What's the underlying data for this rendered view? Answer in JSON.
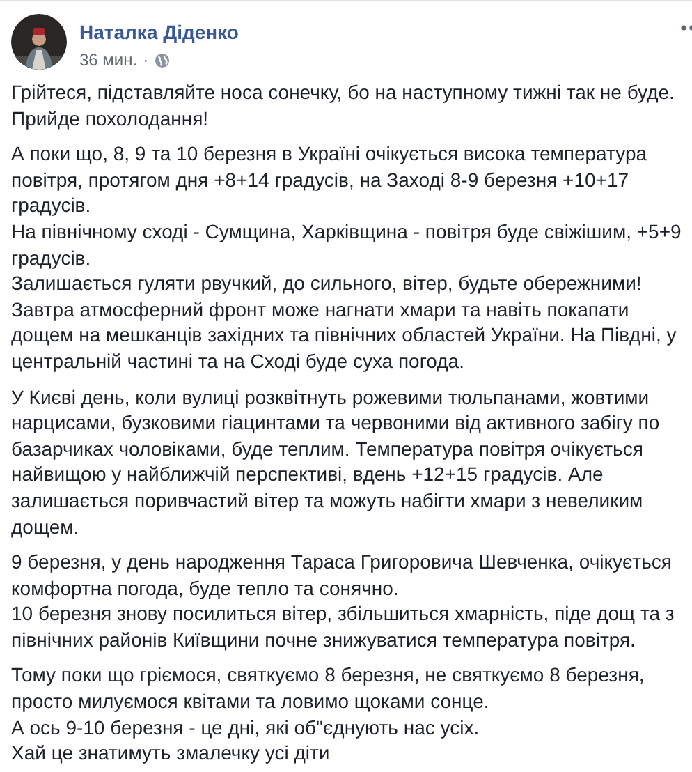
{
  "author": {
    "name": "Наталка Діденко",
    "time": "36 мин.",
    "separator": "·"
  },
  "paragraphs": [
    [
      "Грійтеся, підставляйте носа сонечку, бо на наступному тижні так не буде. Прийде похолодання!"
    ],
    [
      "А поки що, 8, 9 та 10 березня в Україні очікується висока температура повітря, протягом дня +8+14 градусів, на Заході 8-9 березня +10+17 градусів.",
      "На північному сході - Сумщина, Харківщина - повітря буде свіжішим, +5+9 градусів.",
      "Залишається гуляти рвучкий, до сильного, вітер, будьте обережними!",
      "Завтра атмосферний фронт може нагнати хмари та навіть покапати дощем на мешканців західних та північних областей України. На Півдні, у центральній частині та на Сході буде суха погода."
    ],
    [
      "У Києві день, коли вулиці розквітнуть рожевими тюльпанами, жовтими нарцисами, бузковими гіацинтами та червоними від активного забігу по базарчиках чоловіками, буде теплим. Температура повітря очікується найвищою у найближчій перспективі, вдень +12+15 градусів. Але залишається поривчастий вітер та можуть набігти хмари з невеликим дощем."
    ],
    [
      "9 березня, у день народження Тараса Григоровича Шевченка, очікується комфортна погода, буде тепло та сонячно.",
      "10 березня знову посилиться вітер, збільшиться хмарність, піде дощ та з північних районів Київщини почне знижуватися температура повітря."
    ],
    [
      "Тому поки що гріємося, святкуємо 8 березня, не святкуємо 8 березня, просто милуємося квітами та ловимо щоками сонце.",
      "А ось 9-10 березня - це дні, які об\"єднують нас усіх.",
      "Хай це знатимуть змалечку усі діти"
    ]
  ]
}
